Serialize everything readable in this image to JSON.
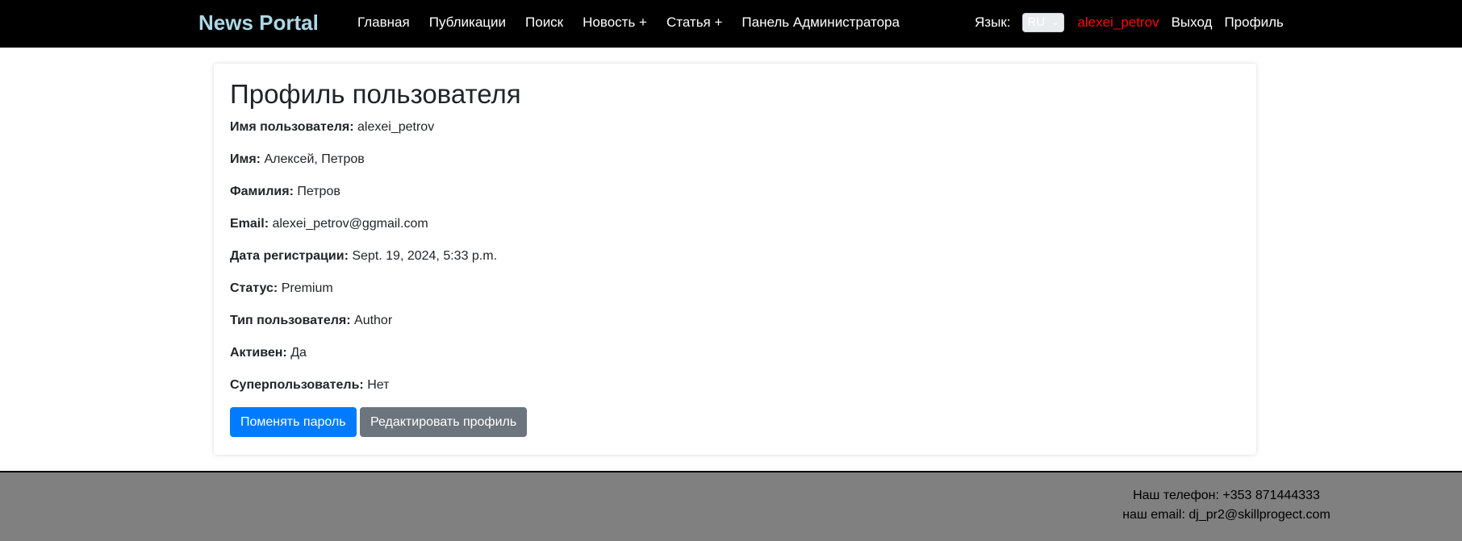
{
  "navbar": {
    "brand": "News Portal",
    "links": [
      "Главная",
      "Публикации",
      "Поиск",
      "Новость +",
      "Статья +",
      "Панель Администратора"
    ],
    "language_label": "Язык:",
    "language_value": "RU",
    "username": "alexei_petrov",
    "logout": "Выход",
    "profile": "Профиль",
    "colors": {
      "brand": "#add8e6",
      "username": "#ff0000"
    }
  },
  "profile": {
    "title": "Профиль пользователя",
    "fields": [
      {
        "label": "Имя пользователя:",
        "value": "alexei_petrov"
      },
      {
        "label": "Имя:",
        "value": "Алексей, Петров"
      },
      {
        "label": "Фамилия:",
        "value": "Петров"
      },
      {
        "label": "Email:",
        "value": "alexei_petrov@ggmail.com"
      },
      {
        "label": "Дата регистрации:",
        "value": "Sept. 19, 2024, 5:33 p.m."
      },
      {
        "label": "Статус:",
        "value": "Premium"
      },
      {
        "label": "Тип пользователя:",
        "value": "Author"
      },
      {
        "label": "Активен:",
        "value": "Да"
      },
      {
        "label": "Суперпользователь:",
        "value": "Нет"
      }
    ],
    "change_password_button": "Поменять пароль",
    "edit_profile_button": "Редактировать профиль",
    "colors": {
      "primary": "#007bff",
      "secondary": "#6c757d"
    }
  },
  "footer": {
    "phone": "Наш телефон: +353 871444333",
    "email": "наш email: dj_pr2@skillprogect.com"
  }
}
